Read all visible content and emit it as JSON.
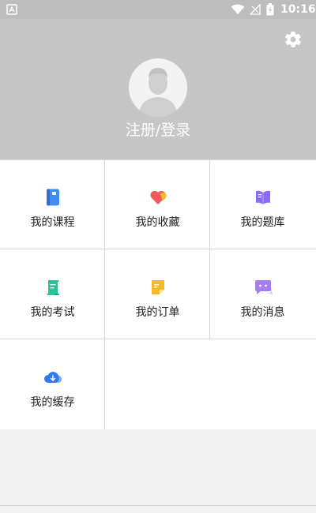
{
  "status_bar": {
    "time": "10:16"
  },
  "header": {
    "login_text": "注册/登录"
  },
  "menu": [
    {
      "label": "我的课程",
      "icon": "course-icon"
    },
    {
      "label": "我的收藏",
      "icon": "favorite-icon"
    },
    {
      "label": "我的题库",
      "icon": "question-bank-icon"
    },
    {
      "label": "我的考试",
      "icon": "exam-icon"
    },
    {
      "label": "我的订单",
      "icon": "order-icon"
    },
    {
      "label": "我的消息",
      "icon": "message-icon"
    },
    {
      "label": "我的缓存",
      "icon": "cache-download-icon"
    }
  ],
  "colors": {
    "header_bg": "#c6c6c6",
    "status_bar_bg": "#bdbdbd",
    "course_blue": "#3f8cf4",
    "favorite_red": "#f05a5a",
    "question_purple": "#8b6cf5",
    "exam_green": "#27c49a",
    "order_yellow": "#f7b928",
    "message_purple": "#a57cf6",
    "cache_blue": "#3478f0"
  }
}
